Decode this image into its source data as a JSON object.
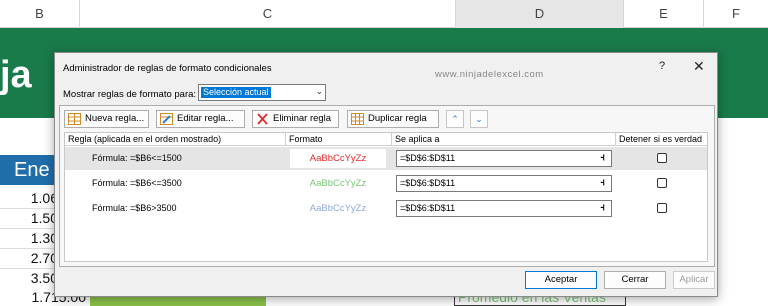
{
  "sheet": {
    "columns": [
      "B",
      "C",
      "D",
      "E",
      "F"
    ],
    "title_fragment": "ja",
    "month_label": "Ene",
    "values": [
      "1.06",
      "1.50",
      "1.30",
      "2.70",
      "3.50",
      "1.715.00"
    ],
    "promedio_label": "Promedio en las Ventas"
  },
  "dialog": {
    "title": "Administrador de reglas de formato condicionales",
    "watermark": "www.ninjadelexcel.com",
    "help": "?",
    "close": "✕",
    "show_label": "Mostrar reglas de formato para:",
    "show_value": "Selección actual",
    "toolbar": {
      "new_rule": "Nueva regla...",
      "edit_rule": "Editar regla...",
      "delete_rule": "Eliminar regla",
      "duplicate_rule": "Duplicar regla"
    },
    "headers": {
      "rule": "Regla (aplicada en el orden mostrado)",
      "format": "Formato",
      "applies_to": "Se aplica a",
      "stop_if_true": "Detener si es verdad"
    },
    "rules": [
      {
        "rule": "Fórmula: =$B6<=1500",
        "preview": "AaBbCcYyZz",
        "preview_color": "#e52a2a",
        "applies_to": "=$D$6:$D$11",
        "stop": false
      },
      {
        "rule": "Fórmula: =$B6<=3500",
        "preview": "AaBbCcYyZz",
        "preview_color": "#7cc576",
        "applies_to": "=$D$6:$D$11",
        "stop": false
      },
      {
        "rule": "Fórmula: =$B6>3500",
        "preview": "AaBbCcYyZz",
        "preview_color": "#8fa9d8",
        "applies_to": "=$D$6:$D$11",
        "stop": false
      }
    ],
    "buttons": {
      "accept": "Aceptar",
      "close": "Cerrar",
      "apply": "Aplicar"
    }
  }
}
